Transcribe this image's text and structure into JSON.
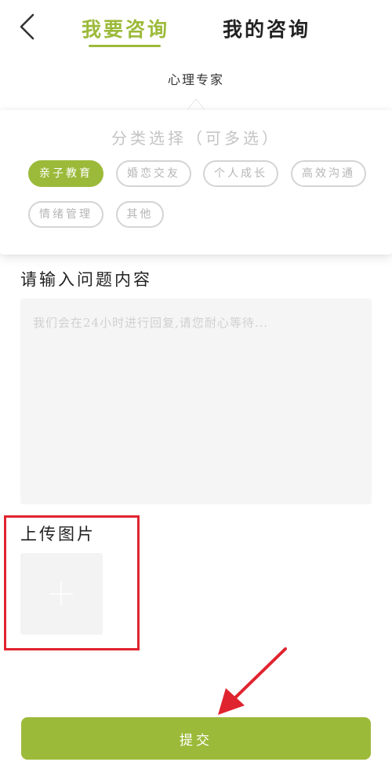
{
  "header": {
    "tabs": [
      {
        "label": "我要咨询",
        "active": true
      },
      {
        "label": "我的咨询",
        "active": false
      }
    ],
    "accent_color": "#9cba3a"
  },
  "expert_type": {
    "label": "心理专家"
  },
  "category_popup": {
    "title": "分类选择（可多选）",
    "chips": [
      {
        "label": "亲子教育",
        "selected": true
      },
      {
        "label": "婚恋交友",
        "selected": false
      },
      {
        "label": "个人成长",
        "selected": false
      },
      {
        "label": "高效沟通",
        "selected": false
      },
      {
        "label": "情绪管理",
        "selected": false
      },
      {
        "label": "其他",
        "selected": false
      }
    ]
  },
  "question": {
    "title": "请输入问题内容",
    "value": "",
    "placeholder": "我们会在24小时进行回复,请您耐心等待..."
  },
  "upload": {
    "title": "上传图片"
  },
  "submit": {
    "label": "提交"
  },
  "annotation_color": "#e0242f"
}
